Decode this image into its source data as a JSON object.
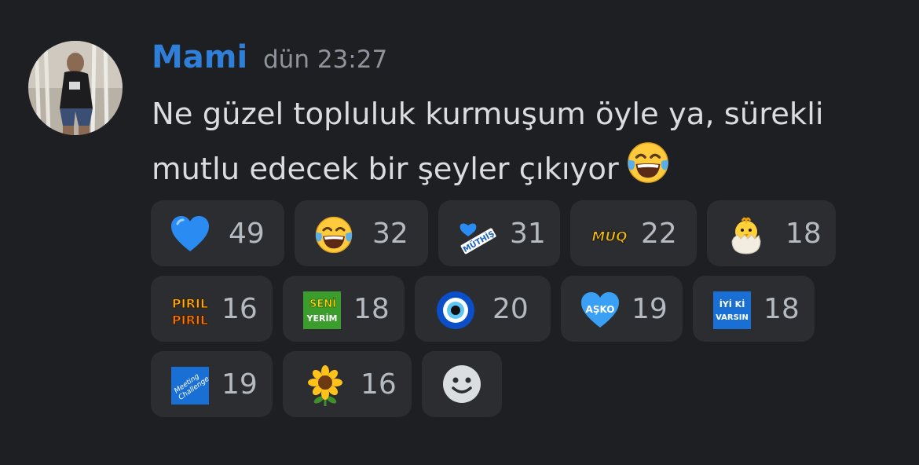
{
  "message": {
    "author": "Mami",
    "timestamp": "dün 23:27",
    "text": "Ne güzel topluluk kurmuşum öyle ya, sürekli mutlu edecek bir şeyler çıkıyor",
    "inline_emoji": "joy-emoji"
  },
  "reactions": [
    {
      "emoji": "blue-heart",
      "count": "49"
    },
    {
      "emoji": "joy",
      "count": "32"
    },
    {
      "emoji": "muthis-sticker",
      "count": "31",
      "sticker_text": "MÜTHİŞ"
    },
    {
      "emoji": "muq-sticker",
      "count": "22",
      "sticker_text": "MÜQ"
    },
    {
      "emoji": "hatching-chick",
      "count": "18"
    },
    {
      "emoji": "piril-piril-sticker",
      "count": "16",
      "sticker_text_1": "PIRIL",
      "sticker_text_2": "PIRIL"
    },
    {
      "emoji": "seni-yerim-sticker",
      "count": "18",
      "sticker_text_1": "SENİ",
      "sticker_text_2": "YERİM"
    },
    {
      "emoji": "nazar-amulet",
      "count": "20"
    },
    {
      "emoji": "asko-heart-sticker",
      "count": "19",
      "sticker_text": "AŞKO"
    },
    {
      "emoji": "iyi-ki-varsin-sticker",
      "count": "18",
      "sticker_text_1": "İYİ Kİ",
      "sticker_text_2": "VARSIN"
    },
    {
      "emoji": "meeting-challenge-sticker",
      "count": "19",
      "sticker_text_1": "Meeting",
      "sticker_text_2": "Challenge"
    },
    {
      "emoji": "sunflower",
      "count": "16"
    }
  ],
  "add_reaction": {
    "icon": "smiley-add-reaction-icon"
  },
  "colors": {
    "background": "#1e1f22",
    "reaction_bg": "#2b2d31",
    "username": "#2f7fd8",
    "timestamp": "#8f939b",
    "text": "#dadce0",
    "count": "#b5bac1"
  }
}
